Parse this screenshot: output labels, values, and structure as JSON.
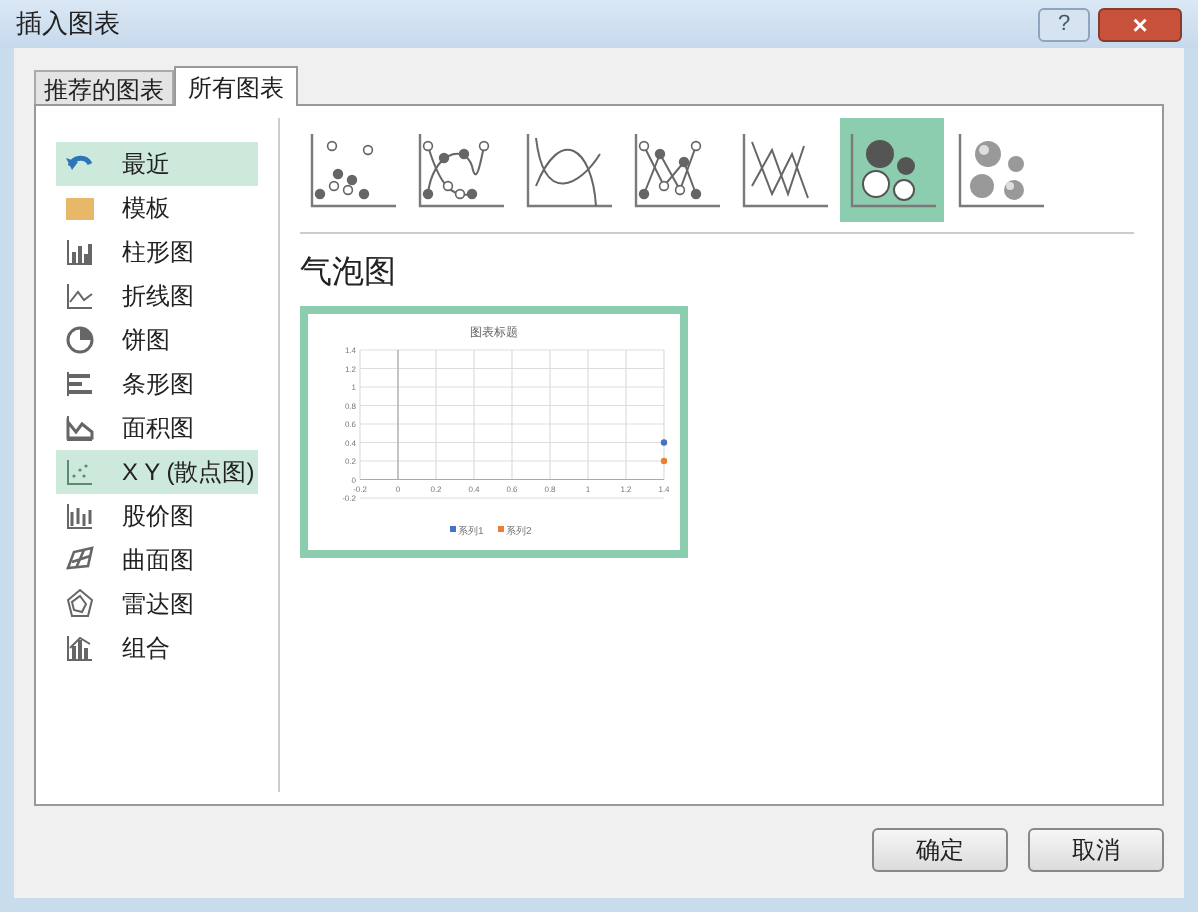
{
  "window": {
    "title": "插入图表",
    "help_button": "?",
    "close_button": "×"
  },
  "tabs": [
    {
      "label": "推荐的图表",
      "selected": false
    },
    {
      "label": "所有图表",
      "selected": true
    }
  ],
  "sidebar": {
    "items": [
      {
        "label": "最近",
        "selected": true
      },
      {
        "label": "模板",
        "selected": false
      },
      {
        "label": "柱形图",
        "selected": false
      },
      {
        "label": "折线图",
        "selected": false
      },
      {
        "label": "饼图",
        "selected": false
      },
      {
        "label": "条形图",
        "selected": false
      },
      {
        "label": "面积图",
        "selected": false
      },
      {
        "label": "X Y (散点图)",
        "selected": true
      },
      {
        "label": "股价图",
        "selected": false
      },
      {
        "label": "曲面图",
        "selected": false
      },
      {
        "label": "雷达图",
        "selected": false
      },
      {
        "label": "组合",
        "selected": false
      }
    ]
  },
  "subtypes": [
    {
      "selected": false
    },
    {
      "selected": false
    },
    {
      "selected": false
    },
    {
      "selected": false
    },
    {
      "selected": false
    },
    {
      "selected": true
    },
    {
      "selected": false
    }
  ],
  "section_title": "气泡图",
  "preview": {
    "chart_data": {
      "type": "scatter",
      "title": "图表标题",
      "x": [
        1.4
      ],
      "series": [
        {
          "name": "系列1",
          "color": "#4472c4",
          "values": [
            0.4
          ]
        },
        {
          "name": "系列2",
          "color": "#ed7d31",
          "values": [
            0.2
          ]
        }
      ],
      "xlim": [
        -0.2,
        1.4
      ],
      "ylim": [
        -0.2,
        1.4
      ],
      "xticks": [
        -0.2,
        0,
        0.2,
        0.4,
        0.6,
        0.8,
        1,
        1.2,
        1.4
      ],
      "yticks": [
        -0.2,
        0,
        0.2,
        0.4,
        0.6,
        0.8,
        1,
        1.2,
        1.4
      ],
      "grid": true,
      "legend": "bottom"
    }
  },
  "buttons": [
    "确定",
    "取消"
  ]
}
